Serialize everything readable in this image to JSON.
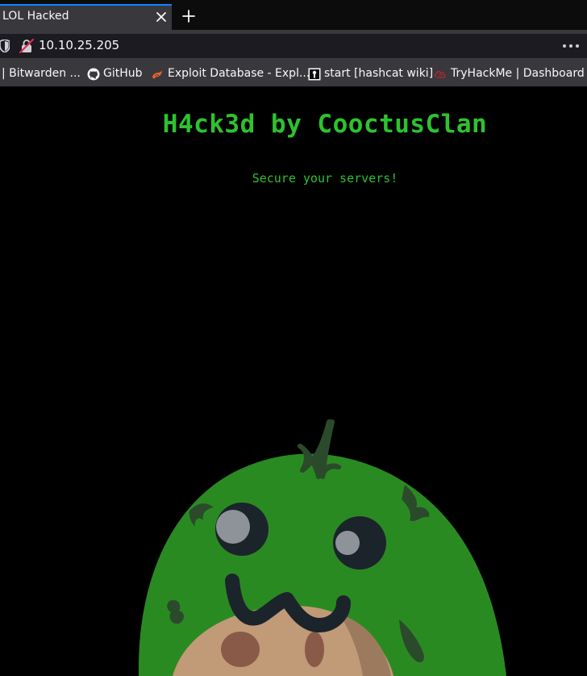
{
  "browser": {
    "tab": {
      "title": "LOL Hacked"
    },
    "url": "10.10.25.205"
  },
  "bookmarks": [
    {
      "label": "| Bitwarden ...",
      "icon": "bitwarden-icon"
    },
    {
      "label": "GitHub",
      "icon": "github-icon"
    },
    {
      "label": "Exploit Database - Expl...",
      "icon": "exploit-db-icon"
    },
    {
      "label": "start [hashcat wiki]",
      "icon": "hashcat-icon"
    },
    {
      "label": "TryHackMe | Dashboard",
      "icon": "tryhackme-icon"
    }
  ],
  "page": {
    "headline": "H4ck3d by CooctusClan",
    "subline": "Secure your servers!"
  },
  "colors": {
    "accent_text": "#2ec22e",
    "background": "#000000",
    "tab_active": "#38383d",
    "mascot_green": "#2a8a22",
    "mascot_face": "#c19a78"
  }
}
